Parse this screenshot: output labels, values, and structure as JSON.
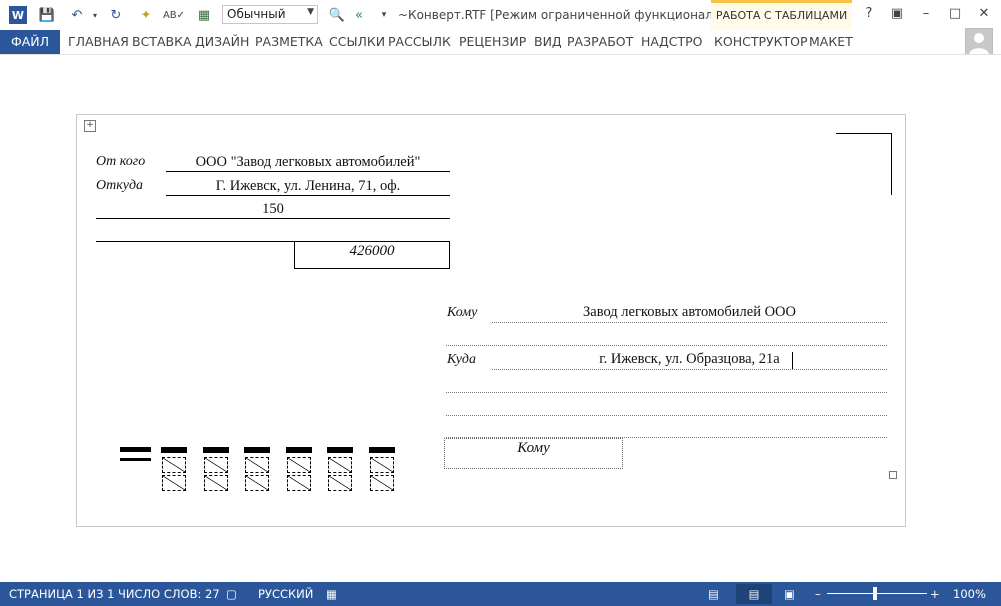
{
  "titlebar": {
    "style_value": "Обычный",
    "doc_title": "~Конверт.RTF [Режим ограниченной функциональн...",
    "table_tools": "РАБОТА С ТАБЛИЦАМИ",
    "help": "?"
  },
  "ribbon": {
    "file": "ФАЙЛ",
    "tabs": [
      "ГЛАВНАЯ",
      "ВСТАВКА",
      "ДИЗАЙН",
      "РАЗМЕТКА",
      "ССЫЛКИ",
      "РАССЫЛК",
      "РЕЦЕНЗИР",
      "ВИД",
      "РАЗРАБОТ",
      "НАДСТРО"
    ],
    "ctx_tabs": [
      "КОНСТРУКТОР",
      "МАКЕТ"
    ]
  },
  "envelope": {
    "from_label": "От кого",
    "from_value": "ООО \"Завод легковых автомобилей\"",
    "whence_label": "Откуда",
    "whence_value": "Г. Ижевск, ул. Ленина, 71, оф.",
    "whence_value2": "150",
    "sender_index": "426000",
    "to_label": "Кому",
    "to_value": "Завод легковых автомобилей ООО",
    "where_label": "Куда",
    "where_value": "г. Ижевск, ул. Образцова, 21а",
    "recipient_index_label": "Кому"
  },
  "status": {
    "page": "СТРАНИЦА 1 ИЗ 1",
    "words": "ЧИСЛО СЛОВ: 27",
    "lang": "РУССКИЙ",
    "zoom": "100%"
  },
  "colors": {
    "accent": "#2b579a",
    "context": "#f5c242"
  }
}
